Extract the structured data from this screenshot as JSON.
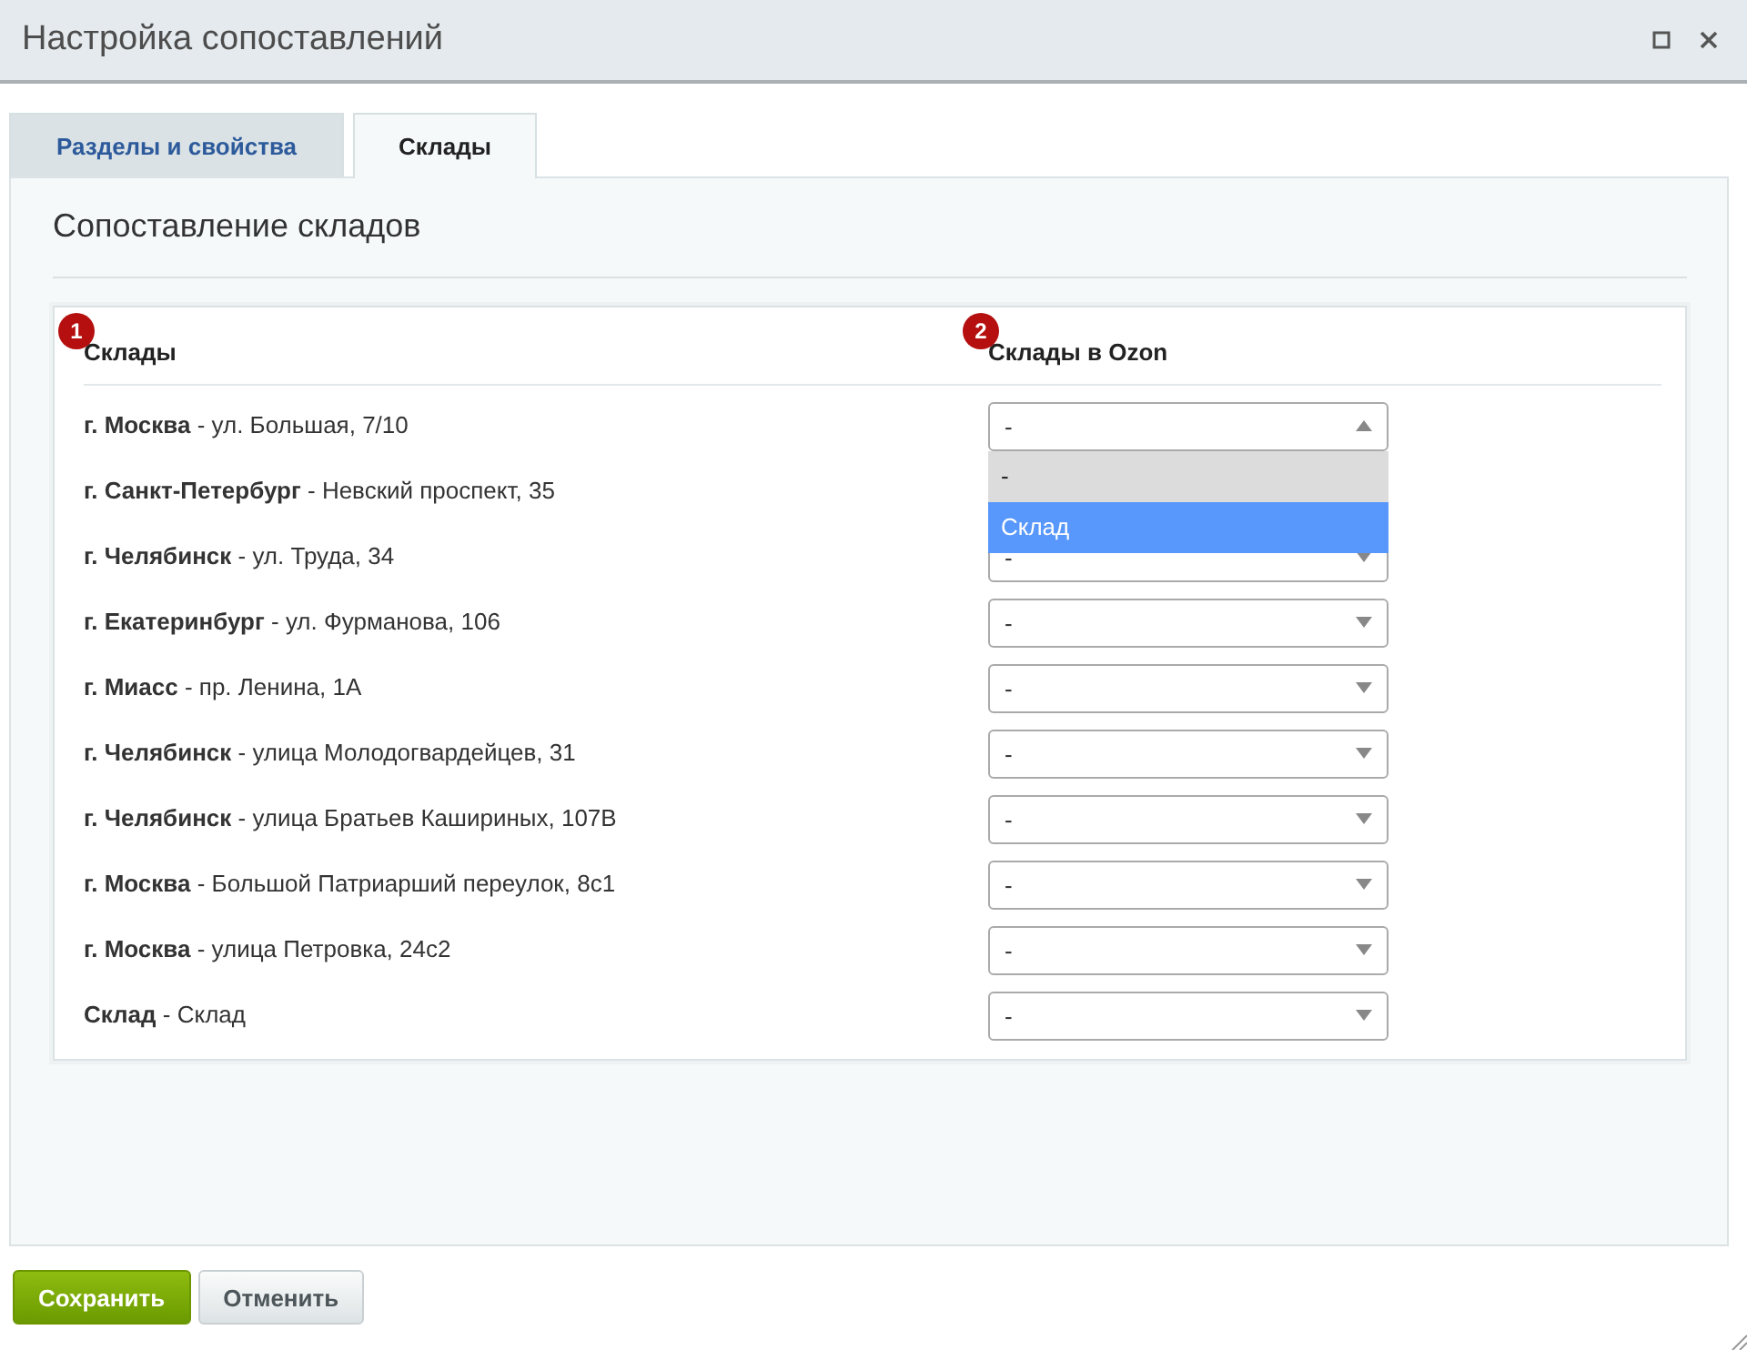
{
  "window": {
    "title": "Настройка сопоставлений"
  },
  "tabs": [
    {
      "label": "Разделы и свойства",
      "selected": false
    },
    {
      "label": "Склады",
      "selected": true
    }
  ],
  "section_title": "Сопоставление складов",
  "table": {
    "columns": [
      {
        "label": "Склады",
        "badge": "1"
      },
      {
        "label": "Склады в Ozon",
        "badge": "2"
      }
    ],
    "rows": [
      {
        "label": "**г. Москва** - ул. Большая, 7/10",
        "select": {
          "value": "-",
          "open": true,
          "options": [
            {
              "label": "-",
              "selected": true,
              "highlighted": false
            },
            {
              "label": "Склад",
              "selected": false,
              "highlighted": true
            }
          ]
        }
      },
      {
        "label": "**г. Санкт-Петербург** - Невский проспект, 35"
      },
      {
        "label": "**г. Челябинск** - ул. Труда, 34",
        "select": {
          "value": "-",
          "open": false
        }
      },
      {
        "label": "**г. Екатеринбург** - ул. Фурманова, 106",
        "select": {
          "value": "-",
          "open": false
        }
      },
      {
        "label": "**г. Миасс** - пр. Ленина, 1А",
        "select": {
          "value": "-",
          "open": false
        }
      },
      {
        "label": "**г. Челябинск** - улица Молодогвардейцев, 31",
        "select": {
          "value": "-",
          "open": false
        }
      },
      {
        "label": "**г. Челябинск** - улица Братьев Кашириных, 107В",
        "select": {
          "value": "-",
          "open": false
        }
      },
      {
        "label": "**г. Москва** - Большой Патриарший переулок, 8с1",
        "select": {
          "value": "-",
          "open": false
        }
      },
      {
        "label": "**г. Москва** - улица Петровка, 24с2",
        "select": {
          "value": "-",
          "open": false
        }
      },
      {
        "label": "**Склад** - Склад",
        "select": {
          "value": "-",
          "open": false
        }
      }
    ]
  },
  "buttons": [
    {
      "label": "Сохранить",
      "kind": "primary"
    },
    {
      "label": "Отменить",
      "kind": "secondary"
    }
  ]
}
